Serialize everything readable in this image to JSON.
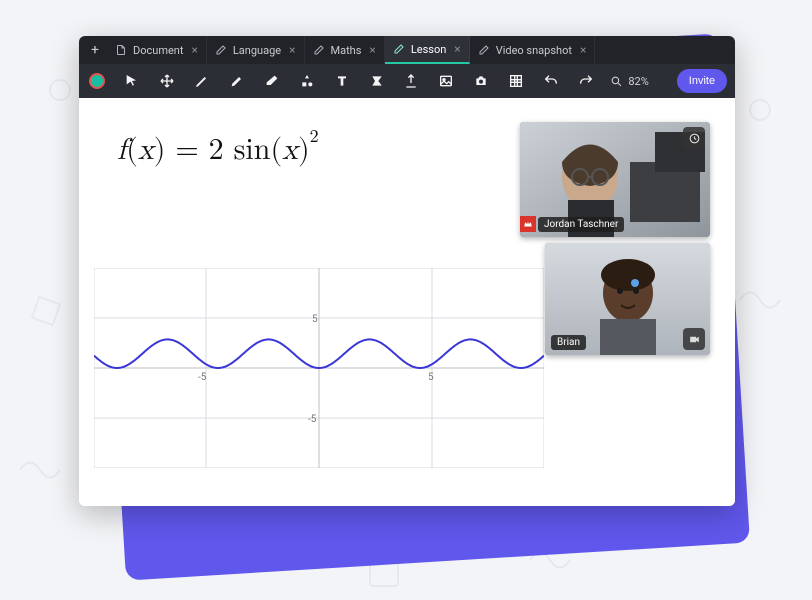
{
  "tabs": [
    {
      "label": "Document",
      "active": false
    },
    {
      "label": "Language",
      "active": false
    },
    {
      "label": "Maths",
      "active": false
    },
    {
      "label": "Lesson",
      "active": true
    },
    {
      "label": "Video snapshot",
      "active": false
    }
  ],
  "toolbar": {
    "zoom_label": "82%",
    "invite_label": "Invite"
  },
  "equation": {
    "raw": "f(x) = 2 sin(x)^2",
    "f": "f",
    "open": "(",
    "x": "x",
    "close": ")",
    "eq": " = ",
    "coef": "2",
    "fn": " sin",
    "open2": "(",
    "x2": "x",
    "close2": ")",
    "exp": "2"
  },
  "chart_data": {
    "type": "line",
    "title": "",
    "xlabel": "",
    "ylabel": "",
    "xlim": [
      -7,
      7
    ],
    "ylim": [
      -7,
      7
    ],
    "xticks": [
      -5,
      5
    ],
    "yticks": [
      -5,
      5
    ],
    "series": [
      {
        "name": "f(x)=2sin(x)^2",
        "formula": "2*sin(x)^2",
        "color": "#3a36d8"
      }
    ]
  },
  "videos": [
    {
      "name": "Jordan Taschner",
      "has_crown": true
    },
    {
      "name": "Brian",
      "has_crown": false
    }
  ],
  "ytick_pos_label": "5",
  "ytick_neg_label": "-5",
  "xtick_pos_label": "5",
  "xtick_neg_label": "-5"
}
